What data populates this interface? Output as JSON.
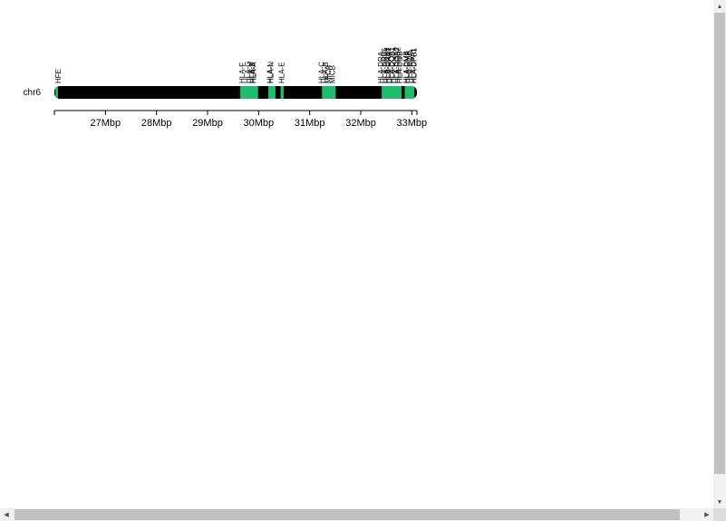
{
  "chart_data": {
    "type": "ideogram",
    "chromosome": "chr6",
    "xlim": [
      26.0,
      33.1
    ],
    "unit": "Mbp",
    "ticks": [
      {
        "value": 27,
        "label": "27Mbp"
      },
      {
        "value": 28,
        "label": "28Mbp"
      },
      {
        "value": 29,
        "label": "29Mbp"
      },
      {
        "value": 30,
        "label": "30Mbp"
      },
      {
        "value": 31,
        "label": "31Mbp"
      },
      {
        "value": 32,
        "label": "32Mbp"
      },
      {
        "value": 33,
        "label": "33Mbp"
      }
    ],
    "highlight_color": "#1dbd6b",
    "bar_color": "#000000",
    "highlights": [
      {
        "start": 26.02,
        "end": 26.07
      },
      {
        "start": 29.64,
        "end": 29.99
      },
      {
        "start": 30.19,
        "end": 30.33
      },
      {
        "start": 30.43,
        "end": 30.49
      },
      {
        "start": 31.24,
        "end": 31.51
      },
      {
        "start": 32.41,
        "end": 32.8
      },
      {
        "start": 32.86,
        "end": 33.05
      }
    ],
    "genes": [
      {
        "label": "HFE",
        "position": 26.09
      },
      {
        "label": "HLA-F",
        "position": 29.69
      },
      {
        "label": "HLA-G",
        "position": 29.8
      },
      {
        "label": "HLA-H",
        "position": 29.86
      },
      {
        "label": "HLA-J",
        "position": 29.89
      },
      {
        "label": "HLA-A",
        "position": 29.91
      },
      {
        "label": "HLA-L",
        "position": 30.23
      },
      {
        "label": "HLA-N",
        "position": 30.25
      },
      {
        "label": "HLA-E",
        "position": 30.46
      },
      {
        "label": "HLA-C",
        "position": 31.24
      },
      {
        "label": "HLA-B",
        "position": 31.32
      },
      {
        "label": "MICA",
        "position": 31.37
      },
      {
        "label": "MICB",
        "position": 31.46
      },
      {
        "label": "HLA-DRA",
        "position": 32.41
      },
      {
        "label": "HLA-DRB5",
        "position": 32.48
      },
      {
        "label": "HLA-DRB6",
        "position": 32.52
      },
      {
        "label": "HLA-DRB1",
        "position": 32.55
      },
      {
        "label": "HLA-DQA1",
        "position": 32.61
      },
      {
        "label": "HLA-DQB1",
        "position": 32.63
      },
      {
        "label": "HLA-DQA2",
        "position": 32.71
      },
      {
        "label": "HLA-DQB2",
        "position": 32.73
      },
      {
        "label": "HLA-DOB",
        "position": 32.78
      },
      {
        "label": "HLA-DMB",
        "position": 32.9
      },
      {
        "label": "HLA-DMA",
        "position": 32.92
      },
      {
        "label": "HLA-DOA",
        "position": 32.97
      },
      {
        "label": "HLA-DPA1",
        "position": 33.04
      },
      {
        "label": "HLA-DPB1",
        "position": 33.05
      }
    ]
  }
}
